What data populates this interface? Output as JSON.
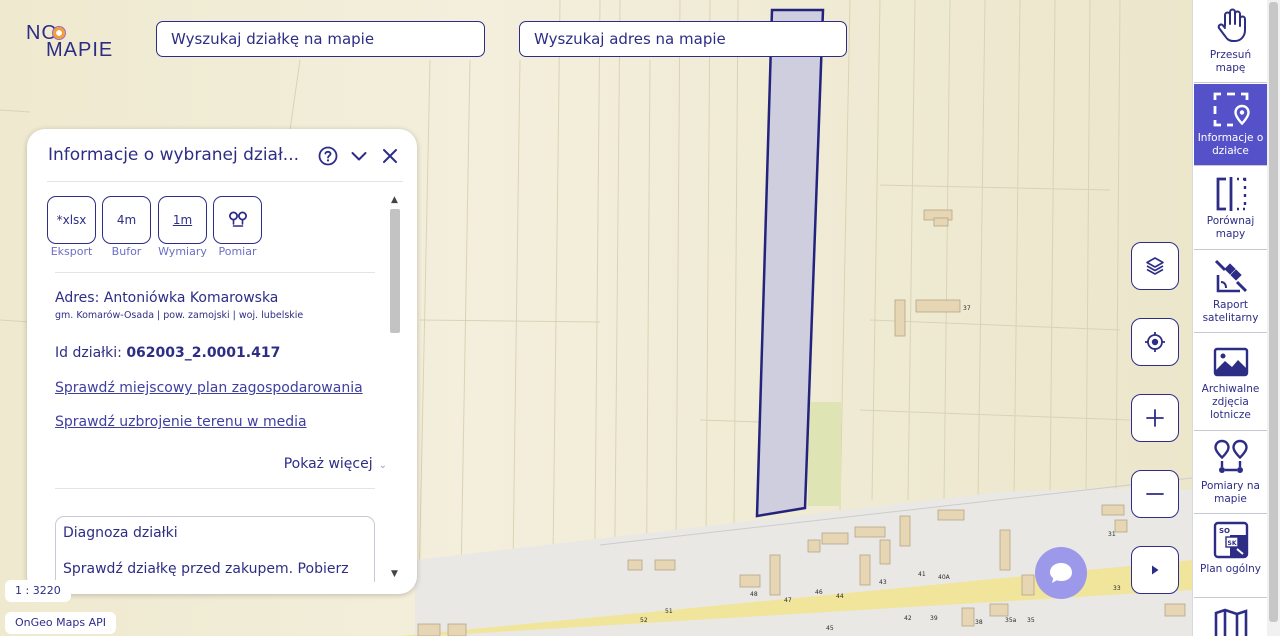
{
  "header": {
    "logo_line1": "NO",
    "logo_line2": "MAPIE",
    "search_parcel_placeholder": "Wyszukaj działkę na mapie",
    "search_address_placeholder": "Wyszukaj adres na mapie"
  },
  "panel": {
    "title": "Informacje o wybranej dział...",
    "tools": [
      {
        "icon_text": "*xlsx",
        "label": "Eksport"
      },
      {
        "icon_text": "4m",
        "label": "Bufor"
      },
      {
        "icon_text": "1m",
        "label": "Wymiary"
      },
      {
        "icon_text": "",
        "label": "Pomiar"
      }
    ],
    "address_label": "Adres: Antoniówka Komarowska",
    "address_sub": "gm. Komarów-Osada | pow. zamojski | woj. lubelskie",
    "id_label": "Id działki: ",
    "id_value": "062003_2.0001.417",
    "link_plan": "Sprawdź miejscowy plan zagospodarowania",
    "link_media": "Sprawdź uzbrojenie terenu w media",
    "show_more": "Pokaż więcej",
    "diag_title": "Diagnoza działki",
    "diag_text": "Sprawdź działkę przed zakupem. Pobierz"
  },
  "map": {
    "scale": "1 : 3220",
    "api_badge": "OnGeo Maps API",
    "house_numbers": [
      "37",
      "31",
      "33",
      "48",
      "47",
      "46",
      "44",
      "43",
      "41",
      "40A",
      "42",
      "39",
      "38",
      "35a",
      "35",
      "45",
      "52",
      "51",
      "33"
    ]
  },
  "toolbar": {
    "items": [
      {
        "label": "Przesuń mapę",
        "icon": "hand-icon",
        "active": false
      },
      {
        "label": "Informacje o działce",
        "icon": "parcel-info-icon",
        "active": true
      },
      {
        "label": "Porównaj mapy",
        "icon": "compare-icon",
        "active": false
      },
      {
        "label": "Raport satelitarny",
        "icon": "satellite-icon",
        "active": false
      },
      {
        "label": "Archiwalne zdjęcia lotnicze",
        "icon": "photo-icon",
        "active": false
      },
      {
        "label": "Pomiary na mapie",
        "icon": "measure-icon",
        "active": false
      },
      {
        "label": "Plan ogólny",
        "icon": "plan-icon",
        "active": false
      }
    ]
  },
  "colors": {
    "brand": "#2d2d86",
    "active": "#5551c8",
    "parcel_fill": "#c9c9df",
    "map_bg": "#f2efdc"
  }
}
